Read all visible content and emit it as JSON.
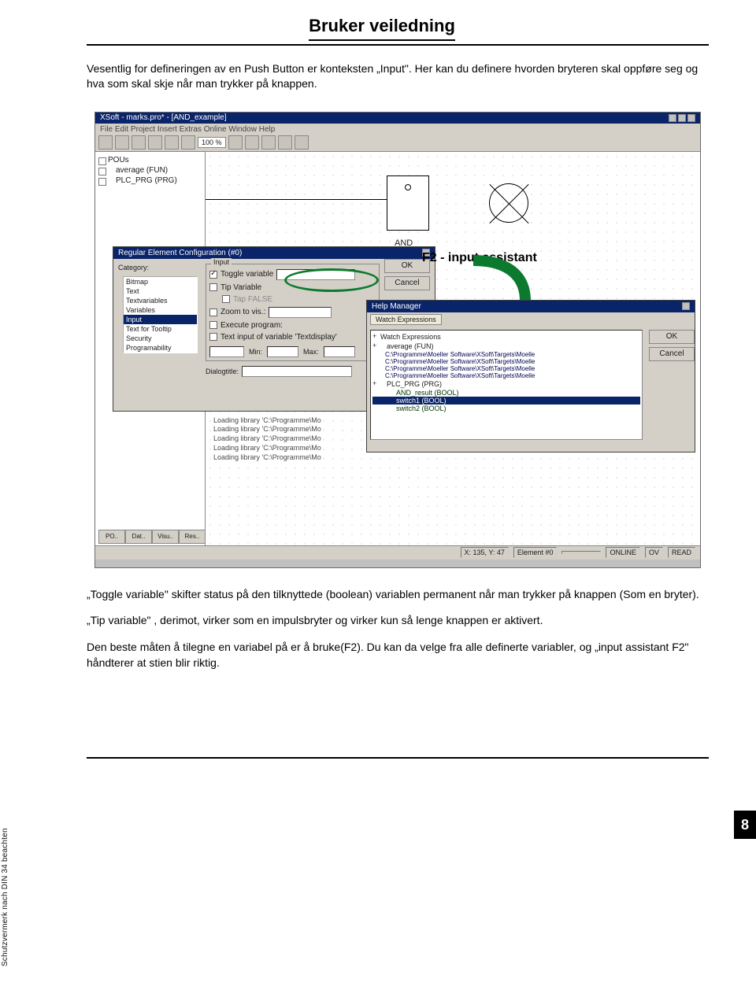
{
  "page": {
    "title": "Bruker veiledning",
    "intro": "Vesentlig for defineringen av en Push Button er konteksten „Input\". Her kan du definere hvorden bryteren skal oppføre seg og hva som skal skje når man trykker på knappen.",
    "page_number": "8",
    "side_note": "Schutzvermerk nach DIN 34 beachten"
  },
  "screenshot": {
    "window_title": "XSoft - marks.pro* - [AND_example]",
    "menu": "File   Edit   Project   Insert   Extras   Online   Window   Help",
    "zoom": "100 %",
    "tree": {
      "root": "POUs",
      "items": [
        "average (FUN)",
        "PLC_PRG (PRG)"
      ]
    },
    "canvas": {
      "and_label": "AND"
    },
    "dlg": {
      "title": "Regular Element Configuration (#0)",
      "cat_label": "Category:",
      "categories": [
        "Bitmap",
        "Text",
        "Textvariables",
        "Variables",
        "Input",
        "Text for Tooltip",
        "Security",
        "Programability"
      ],
      "selected_category": "Input",
      "opts": {
        "group": "Input",
        "toggle": "Toggle variable",
        "tip": "Tip Variable",
        "tap": "Tap FALSE",
        "zoom": "Zoom to vis.:",
        "exec": "Execute program:",
        "text": "Text input of variable 'Textdisplay'",
        "min": "Min:",
        "max": "Max:",
        "dialog": "Dialogtitle:"
      },
      "btn_ok": "OK",
      "btn_cancel": "Cancel"
    },
    "f2_annotation": "F2 - input assistant",
    "helpmgr": {
      "title": "Help Manager",
      "tab": "Watch Expressions",
      "tree": [
        "Watch Expressions",
        "average (FUN)",
        "C:\\Programme\\Moeller Software\\XSoft\\Targets\\Moelle",
        "C:\\Programme\\Moeller Software\\XSoft\\Targets\\Moelle",
        "C:\\Programme\\Moeller Software\\XSoft\\Targets\\Moelle",
        "C:\\Programme\\Moeller Software\\XSoft\\Targets\\Moelle",
        "PLC_PRG (PRG)"
      ],
      "leaves": [
        "AND_result (BOOL)",
        "switch1 (BOOL)",
        "switch2 (BOOL)"
      ],
      "selected_leaf": "switch1 (BOOL)",
      "btn_ok": "OK",
      "btn_cancel": "Cancel"
    },
    "log_lines": [
      "Loading library 'C:\\Programme\\Mo",
      "Loading library 'C:\\Programme\\Mo",
      "Loading library 'C:\\Programme\\Mo",
      "Loading library 'C:\\Programme\\Mo",
      "Loading library 'C:\\Programme\\Mo"
    ],
    "bottom_tabs": [
      "PO..",
      "Dat..",
      "Visu..",
      "Res.."
    ],
    "statusbar": {
      "coords": "X:  135, Y:   47",
      "element": "Element #0",
      "online": "ONLINE",
      "ov": "OV",
      "read": "READ"
    }
  },
  "body": {
    "p1": "„Toggle variable\" skifter status på den tilknyttede (boolean) variablen permanent når man trykker på knappen (Som en bryter).",
    "p2": "„Tip variable\" , derimot, virker som en impulsbryter og virker kun så lenge knappen er aktivert.",
    "p3": "Den beste måten å tilegne en variabel på er å bruke(F2). Du kan da velge fra alle definerte variabler, og „input assistant F2\" håndterer at stien blir riktig."
  }
}
